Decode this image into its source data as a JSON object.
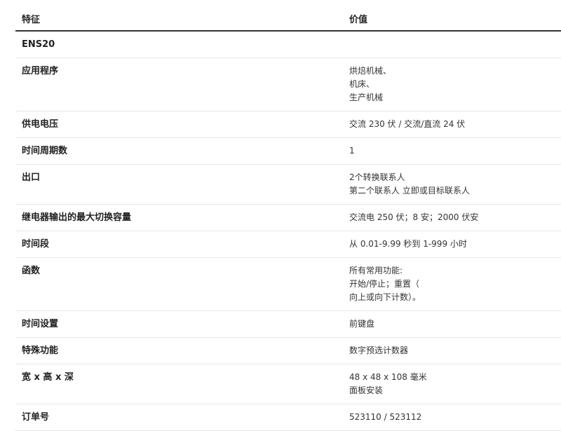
{
  "table": {
    "header": {
      "feature": "特征",
      "value": "价值"
    },
    "rows": [
      {
        "name": "product-name",
        "feature": "ENS20",
        "values": []
      },
      {
        "name": "application",
        "feature": "应用程序",
        "values": [
          "烘焙机械、",
          "机床、",
          "生产机械"
        ]
      },
      {
        "name": "supply-voltage",
        "feature": "供电电压",
        "values": [
          "交流 230 伏 / 交流/直流 24 伏"
        ]
      },
      {
        "name": "time-periods",
        "feature": "时间周期数",
        "values": [
          "1"
        ]
      },
      {
        "name": "output",
        "feature": "出口",
        "values": [
          "2个转换联系人",
          "第二个联系人 立即或目标联系人"
        ]
      },
      {
        "name": "relay-capacity",
        "feature": "继电器输出的最大切换容量",
        "values": [
          "交流电 250 伏；8 安；2000 伏安"
        ]
      },
      {
        "name": "time-range",
        "feature": "时间段",
        "values": [
          "从 0.01-9.99 秒到 1-999 小时"
        ]
      },
      {
        "name": "functions",
        "feature": "函数",
        "values": [
          "所有常用功能:",
          "开始/停止；重置（",
          "向上或向下计数）。"
        ]
      },
      {
        "name": "time-setting",
        "feature": "时间设置",
        "values": [
          "前键盘"
        ]
      },
      {
        "name": "special-functions",
        "feature": "特殊功能",
        "values": [
          "数字预选计数器"
        ]
      },
      {
        "name": "dimensions",
        "feature": "宽 x 高 x 深",
        "values": [
          "48 x 48 x 108 毫米",
          "面板安装"
        ]
      },
      {
        "name": "order-number",
        "feature": "订单号",
        "values": [
          "523110 / 523112"
        ]
      }
    ]
  }
}
